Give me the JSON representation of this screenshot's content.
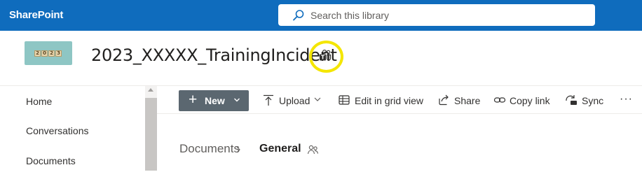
{
  "suite": {
    "brand": "SharePoint",
    "search_placeholder": "Search this library",
    "bg_color": "#0f6cbd"
  },
  "site": {
    "title": "2023_XXXXX_TrainingIncident",
    "logo_text": [
      "2",
      "0",
      "2",
      "3"
    ],
    "teams_icon": "teams-icon",
    "highlight_color": "#f4e600"
  },
  "nav": {
    "items": [
      {
        "label": "Home"
      },
      {
        "label": "Conversations"
      },
      {
        "label": "Documents"
      }
    ]
  },
  "commandbar": {
    "new_label": "New",
    "upload_label": "Upload",
    "edit_grid_label": "Edit in grid view",
    "share_label": "Share",
    "copy_link_label": "Copy link",
    "sync_label": "Sync",
    "more_label": "···"
  },
  "breadcrumb": {
    "root": "Documents",
    "current": "General"
  }
}
